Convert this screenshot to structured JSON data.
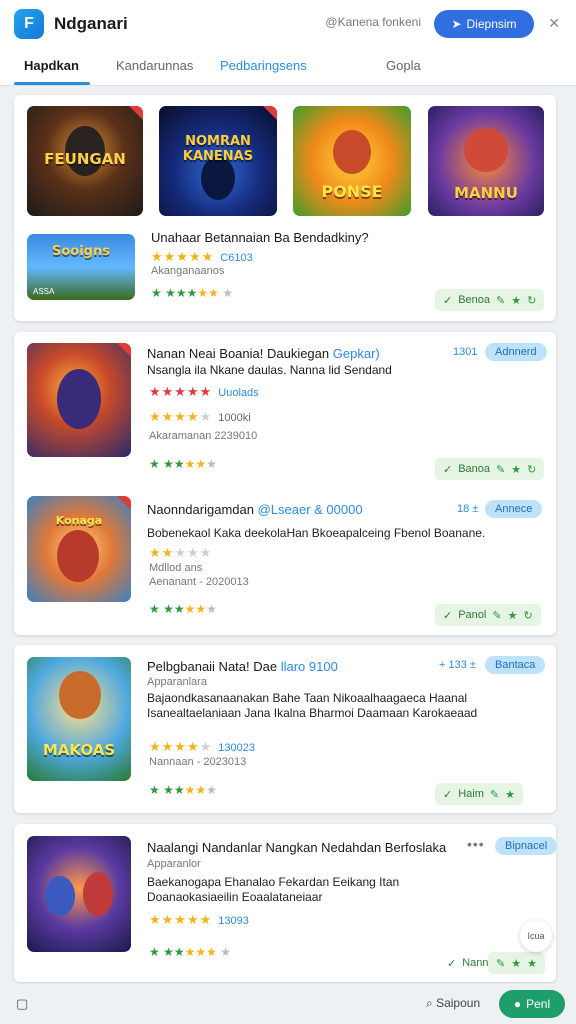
{
  "app": {
    "title": "Ndganari",
    "logo_letter": "F",
    "account": "@Kanena fonkeni",
    "header_button": "Diepnsim",
    "close": "✕"
  },
  "tabs": [
    {
      "label": "Hapdkan"
    },
    {
      "label": "Kandarunnas"
    },
    {
      "label": "Pedbaringsens"
    },
    {
      "label": "Gopla"
    }
  ],
  "card1": {
    "thumbs": [
      {
        "art": "FEUNGAN"
      },
      {
        "art": "NOMRAN KANENAS"
      },
      {
        "art": "PONSE"
      },
      {
        "art": "MANNU"
      }
    ],
    "small_thumb": {
      "art": "Sooigns",
      "caption": "ASSA"
    },
    "title": "Unahaar Betannaian Ba Bendadkiny?",
    "rating_text": "C6103",
    "subtitle": "Akanganaanos",
    "pill": {
      "label": "Benoa"
    }
  },
  "card2": {
    "items": [
      {
        "art": "",
        "title": "Nanan Neai Boania! Daukiegan",
        "tag": "Gepkar)",
        "title2": "Nsangla ila Nkane daulas. Nanna lid Sendand",
        "time": "1301",
        "badge": "Adnnerd",
        "rating_text": "Uuolads",
        "rating_text2": "1000ki",
        "meta": "Akaramanan 2239010",
        "pill": "Banoa"
      },
      {
        "art": "Konaga",
        "title": "Naonndarigamdan",
        "tag": "@Lseaer & 00000",
        "desc": "Bobenekaol Kaka deekolaHan Bkoeapalceing Fbenol Boanane.",
        "time": "18 ±",
        "badge": "Annece",
        "sub1": "Mdllod ans",
        "meta": "Aenanant - 2020013",
        "pill": "Panol"
      }
    ]
  },
  "card3": {
    "art": "MAKOAS",
    "title": "Pelbgbanaii Nata! Dae",
    "tag": "llaro 9100",
    "time": "+ 133 ±",
    "badge": "Bantaca",
    "sub1": "Apparanlara",
    "desc": "Bajaondkasanaanakan Bahe Taan Nikoaalhaagaeca Haanal Isanealtaelaniaan Jana Ikalna Bharmoi Daamaan Karokaeaad",
    "rating_text": "130023",
    "meta": "Nannaan - 2023013",
    "pill": "Haim"
  },
  "card4": {
    "title": "Naalangi Nandanlar Nangkan Nedahdan Berfoslaka",
    "badge": "Bipnacel",
    "dots": "•••",
    "sub1": "Apparanlor",
    "desc": "Baekanogapa Ehanalao Fekardan Eeikang Itan Doanaokasiaeilin Eoaalataneiaar",
    "rating_text": "13093",
    "pill": "Nanna"
  },
  "bottom": {
    "left_icon": "▢",
    "search_label": "Saipoun",
    "button": "Penl",
    "float": "Icua"
  },
  "colors": {
    "accent": "#2a8ce0",
    "primary_button": "#2f6fe0",
    "green": "#2e9a3e",
    "star": "#f5b21a"
  }
}
